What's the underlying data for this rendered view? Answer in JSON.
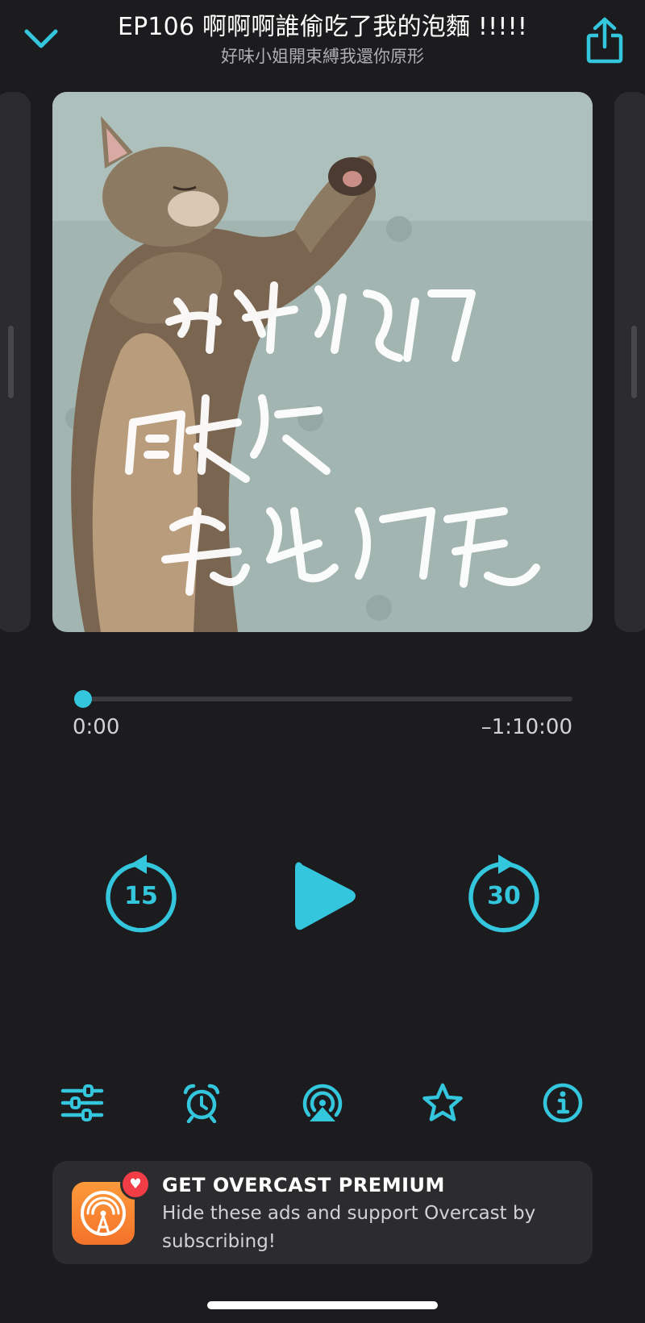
{
  "header": {
    "episode_title": "EP106 啊啊啊誰偷吃了我的泡麵 !!!!!",
    "podcast_title": "好味小姐開束縛我還你原形"
  },
  "artwork": {
    "caption_lines": [
      "好味小姐",
      "開束縛",
      "我還你原型"
    ]
  },
  "playback": {
    "elapsed": "0:00",
    "remaining": "–1:10:00",
    "progress_fraction": 0.0
  },
  "controls": {
    "skip_back_seconds": "15",
    "skip_forward_seconds": "30"
  },
  "toolbar": {
    "icons": [
      "effects-icon",
      "sleep-timer-icon",
      "airplay-icon",
      "star-icon",
      "info-icon"
    ]
  },
  "promo": {
    "title": "GET OVERCAST PREMIUM",
    "body": "Hide these ads and support Overcast by subscribing!"
  },
  "colors": {
    "accent": "#34c6dd",
    "background": "#1c1c1e",
    "card": "#2c2c2e"
  }
}
